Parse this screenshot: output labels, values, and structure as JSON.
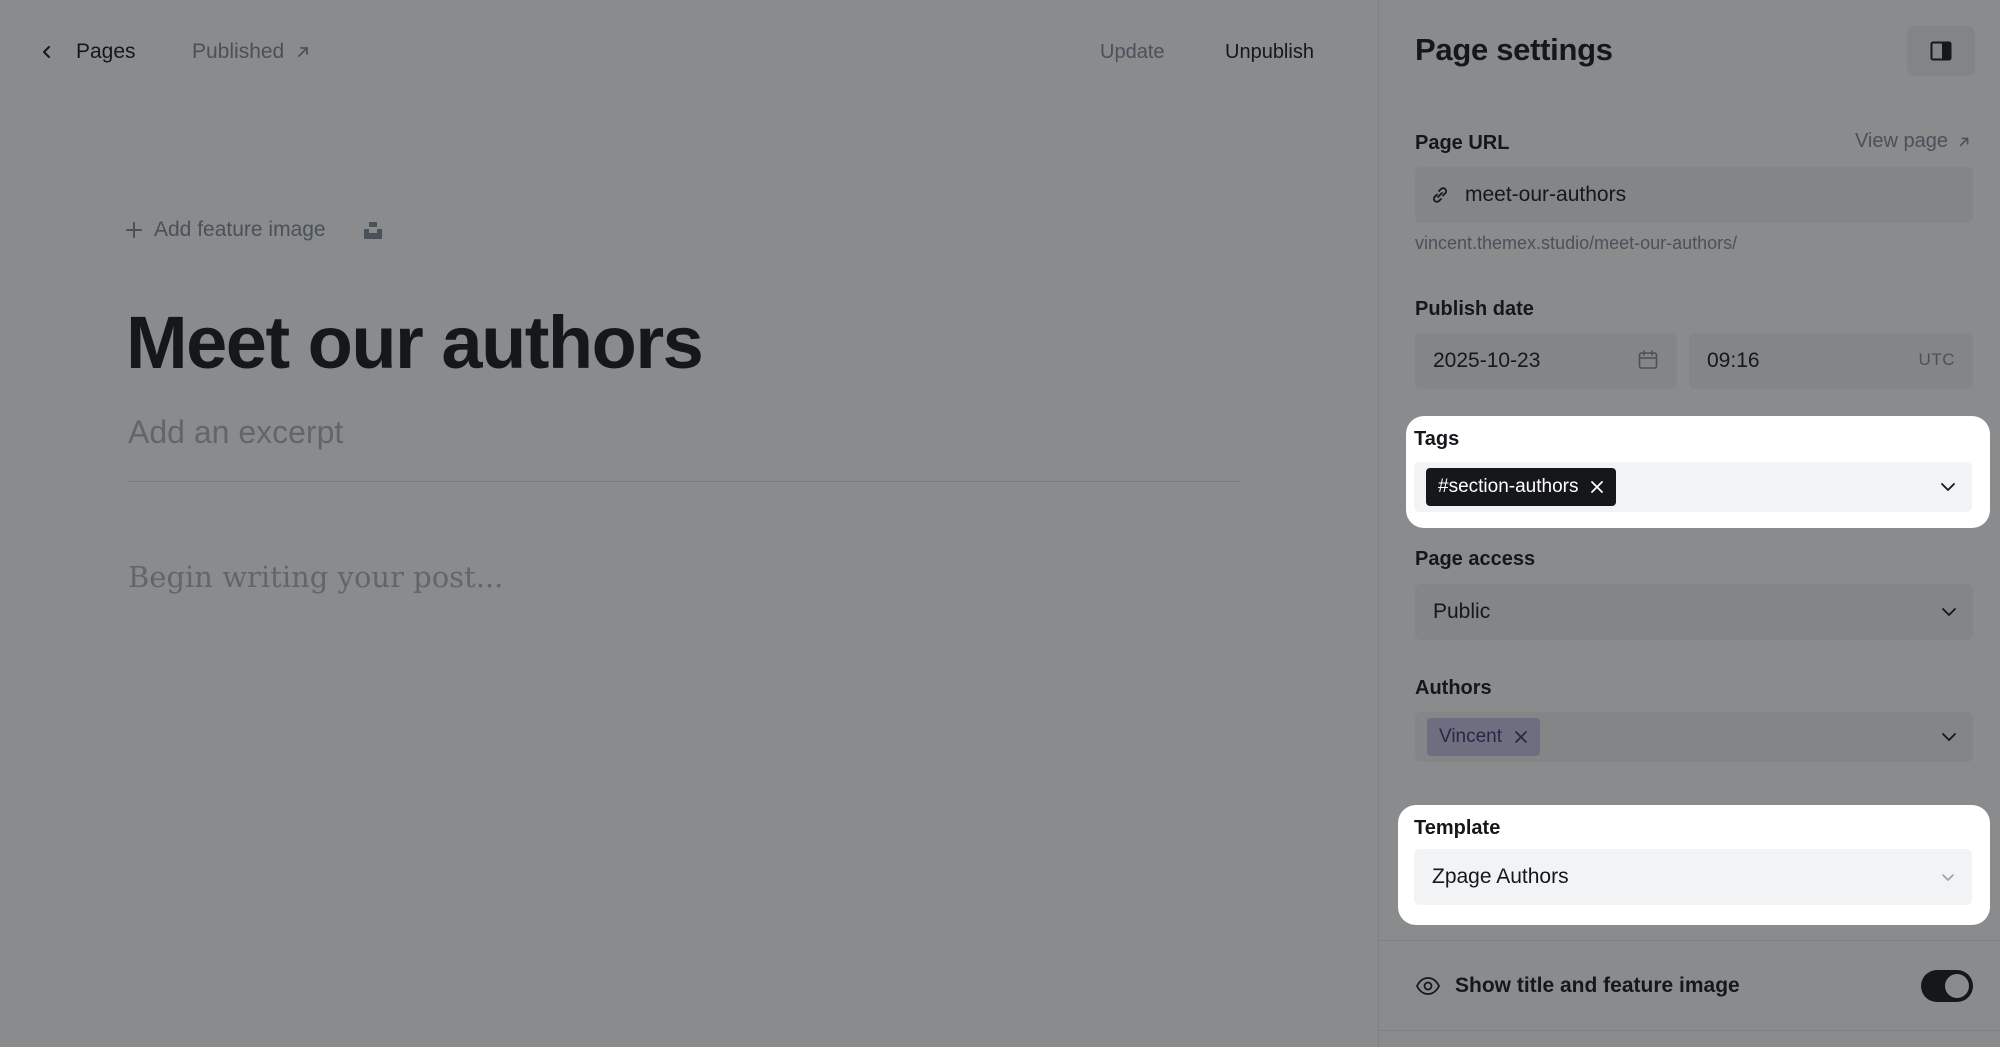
{
  "topbar": {
    "back_label": "Pages",
    "status_label": "Published",
    "update_label": "Update",
    "unpublish_label": "Unpublish"
  },
  "editor": {
    "add_feature_image": "Add feature image",
    "title": "Meet our authors",
    "excerpt_placeholder": "Add an excerpt",
    "body_placeholder": "Begin writing your post..."
  },
  "settings": {
    "title": "Page settings",
    "page_url": {
      "label": "Page URL",
      "view_link": "View page",
      "value": "meet-our-authors",
      "hint": "vincent.themex.studio/meet-our-authors/"
    },
    "publish_date": {
      "label": "Publish date",
      "date": "2025-10-23",
      "time": "09:16",
      "timezone": "UTC"
    },
    "tags": {
      "label": "Tags",
      "items": [
        "#section-authors"
      ]
    },
    "page_access": {
      "label": "Page access",
      "value": "Public"
    },
    "authors": {
      "label": "Authors",
      "items": [
        "Vincent"
      ]
    },
    "template": {
      "label": "Template",
      "value": "Zpage Authors"
    },
    "show_title_toggle": {
      "label": "Show title and feature image",
      "on": true
    }
  },
  "colors": {
    "overlay": "#15171a",
    "tag_bg": "#15171a",
    "author_pill_bg": "#c8c4e6",
    "muted_text": "#7c8b9a",
    "field_bg": "#f1f3f4"
  }
}
